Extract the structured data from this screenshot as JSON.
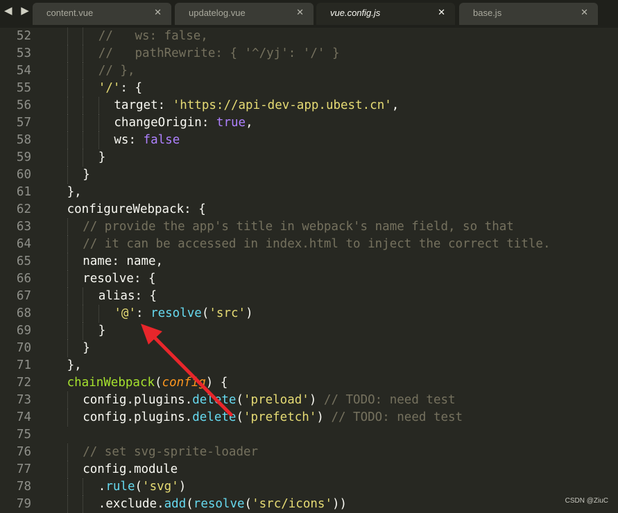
{
  "nav": {
    "arrows": "◀ ▶"
  },
  "tabs": [
    {
      "label": "content.vue",
      "close": "✕",
      "active": false
    },
    {
      "label": "updatelog.vue",
      "close": "✕",
      "active": false
    },
    {
      "label": "vue.config.js",
      "close": "✕",
      "active": true
    },
    {
      "label": "base.js",
      "close": "✕",
      "active": false
    }
  ],
  "lines": [
    {
      "num": "52",
      "indent": 3,
      "tokens": [
        {
          "t": "c",
          "v": "//   ws: false,"
        }
      ]
    },
    {
      "num": "53",
      "indent": 3,
      "tokens": [
        {
          "t": "c",
          "v": "//   pathRewrite: { '^/yj': '/' }"
        }
      ]
    },
    {
      "num": "54",
      "indent": 3,
      "tokens": [
        {
          "t": "c",
          "v": "// },"
        }
      ]
    },
    {
      "num": "55",
      "indent": 3,
      "tokens": [
        {
          "t": "s",
          "v": "'/'"
        },
        {
          "t": "",
          "v": ": {"
        }
      ]
    },
    {
      "num": "56",
      "indent": 4,
      "tokens": [
        {
          "t": "",
          "v": "target: "
        },
        {
          "t": "s",
          "v": "'https://api-dev-app.ubest.cn'"
        },
        {
          "t": "",
          "v": ","
        }
      ]
    },
    {
      "num": "57",
      "indent": 4,
      "tokens": [
        {
          "t": "",
          "v": "changeOrigin: "
        },
        {
          "t": "k",
          "v": "true"
        },
        {
          "t": "",
          "v": ","
        }
      ]
    },
    {
      "num": "58",
      "indent": 4,
      "tokens": [
        {
          "t": "",
          "v": "ws: "
        },
        {
          "t": "k",
          "v": "false"
        }
      ]
    },
    {
      "num": "59",
      "indent": 3,
      "tokens": [
        {
          "t": "",
          "v": "}"
        }
      ]
    },
    {
      "num": "60",
      "indent": 2,
      "tokens": [
        {
          "t": "",
          "v": "}"
        }
      ]
    },
    {
      "num": "61",
      "indent": 1,
      "tokens": [
        {
          "t": "",
          "v": "},"
        }
      ]
    },
    {
      "num": "62",
      "indent": 1,
      "tokens": [
        {
          "t": "",
          "v": "configureWebpack: {"
        }
      ]
    },
    {
      "num": "63",
      "indent": 2,
      "tokens": [
        {
          "t": "c",
          "v": "// provide the app's title in webpack's name field, so that"
        }
      ]
    },
    {
      "num": "64",
      "indent": 2,
      "tokens": [
        {
          "t": "c",
          "v": "// it can be accessed in index.html to inject the correct title."
        }
      ]
    },
    {
      "num": "65",
      "indent": 2,
      "tokens": [
        {
          "t": "",
          "v": "name: name,"
        }
      ]
    },
    {
      "num": "66",
      "indent": 2,
      "tokens": [
        {
          "t": "",
          "v": "resolve: {"
        }
      ]
    },
    {
      "num": "67",
      "indent": 3,
      "tokens": [
        {
          "t": "",
          "v": "alias: {"
        }
      ]
    },
    {
      "num": "68",
      "indent": 4,
      "tokens": [
        {
          "t": "s",
          "v": "'@'"
        },
        {
          "t": "",
          "v": ": "
        },
        {
          "t": "f",
          "v": "resolve"
        },
        {
          "t": "",
          "v": "("
        },
        {
          "t": "s",
          "v": "'src'"
        },
        {
          "t": "",
          "v": ")"
        }
      ]
    },
    {
      "num": "69",
      "indent": 3,
      "tokens": [
        {
          "t": "",
          "v": "}"
        }
      ]
    },
    {
      "num": "70",
      "indent": 2,
      "tokens": [
        {
          "t": "",
          "v": "}"
        }
      ]
    },
    {
      "num": "71",
      "indent": 1,
      "tokens": [
        {
          "t": "",
          "v": "},"
        }
      ]
    },
    {
      "num": "72",
      "indent": 1,
      "tokens": [
        {
          "t": "g",
          "v": "chainWebpack"
        },
        {
          "t": "",
          "v": "("
        },
        {
          "t": "p",
          "v": "config"
        },
        {
          "t": "",
          "v": ") {"
        }
      ]
    },
    {
      "num": "73",
      "indent": 2,
      "tokens": [
        {
          "t": "",
          "v": "config.plugins."
        },
        {
          "t": "f",
          "v": "delete"
        },
        {
          "t": "",
          "v": "("
        },
        {
          "t": "s",
          "v": "'preload'"
        },
        {
          "t": "",
          "v": ") "
        },
        {
          "t": "c",
          "v": "// TODO: need test"
        }
      ]
    },
    {
      "num": "74",
      "indent": 2,
      "tokens": [
        {
          "t": "",
          "v": "config.plugins."
        },
        {
          "t": "f",
          "v": "delete"
        },
        {
          "t": "",
          "v": "("
        },
        {
          "t": "s",
          "v": "'prefetch'"
        },
        {
          "t": "",
          "v": ") "
        },
        {
          "t": "c",
          "v": "// TODO: need test"
        }
      ]
    },
    {
      "num": "75",
      "indent": 0,
      "tokens": []
    },
    {
      "num": "76",
      "indent": 2,
      "tokens": [
        {
          "t": "c",
          "v": "// set svg-sprite-loader"
        }
      ]
    },
    {
      "num": "77",
      "indent": 2,
      "tokens": [
        {
          "t": "",
          "v": "config.module"
        }
      ]
    },
    {
      "num": "78",
      "indent": 3,
      "tokens": [
        {
          "t": "",
          "v": "."
        },
        {
          "t": "f",
          "v": "rule"
        },
        {
          "t": "",
          "v": "("
        },
        {
          "t": "s",
          "v": "'svg'"
        },
        {
          "t": "",
          "v": ")"
        }
      ]
    },
    {
      "num": "79",
      "indent": 3,
      "tokens": [
        {
          "t": "",
          "v": ".exclude."
        },
        {
          "t": "f",
          "v": "add"
        },
        {
          "t": "",
          "v": "("
        },
        {
          "t": "f",
          "v": "resolve"
        },
        {
          "t": "",
          "v": "("
        },
        {
          "t": "s",
          "v": "'src/icons'"
        },
        {
          "t": "",
          "v": "))"
        }
      ]
    }
  ],
  "annotation": {
    "arrow_color": "#e8262b"
  },
  "watermark": "CSDN @ZiuC"
}
